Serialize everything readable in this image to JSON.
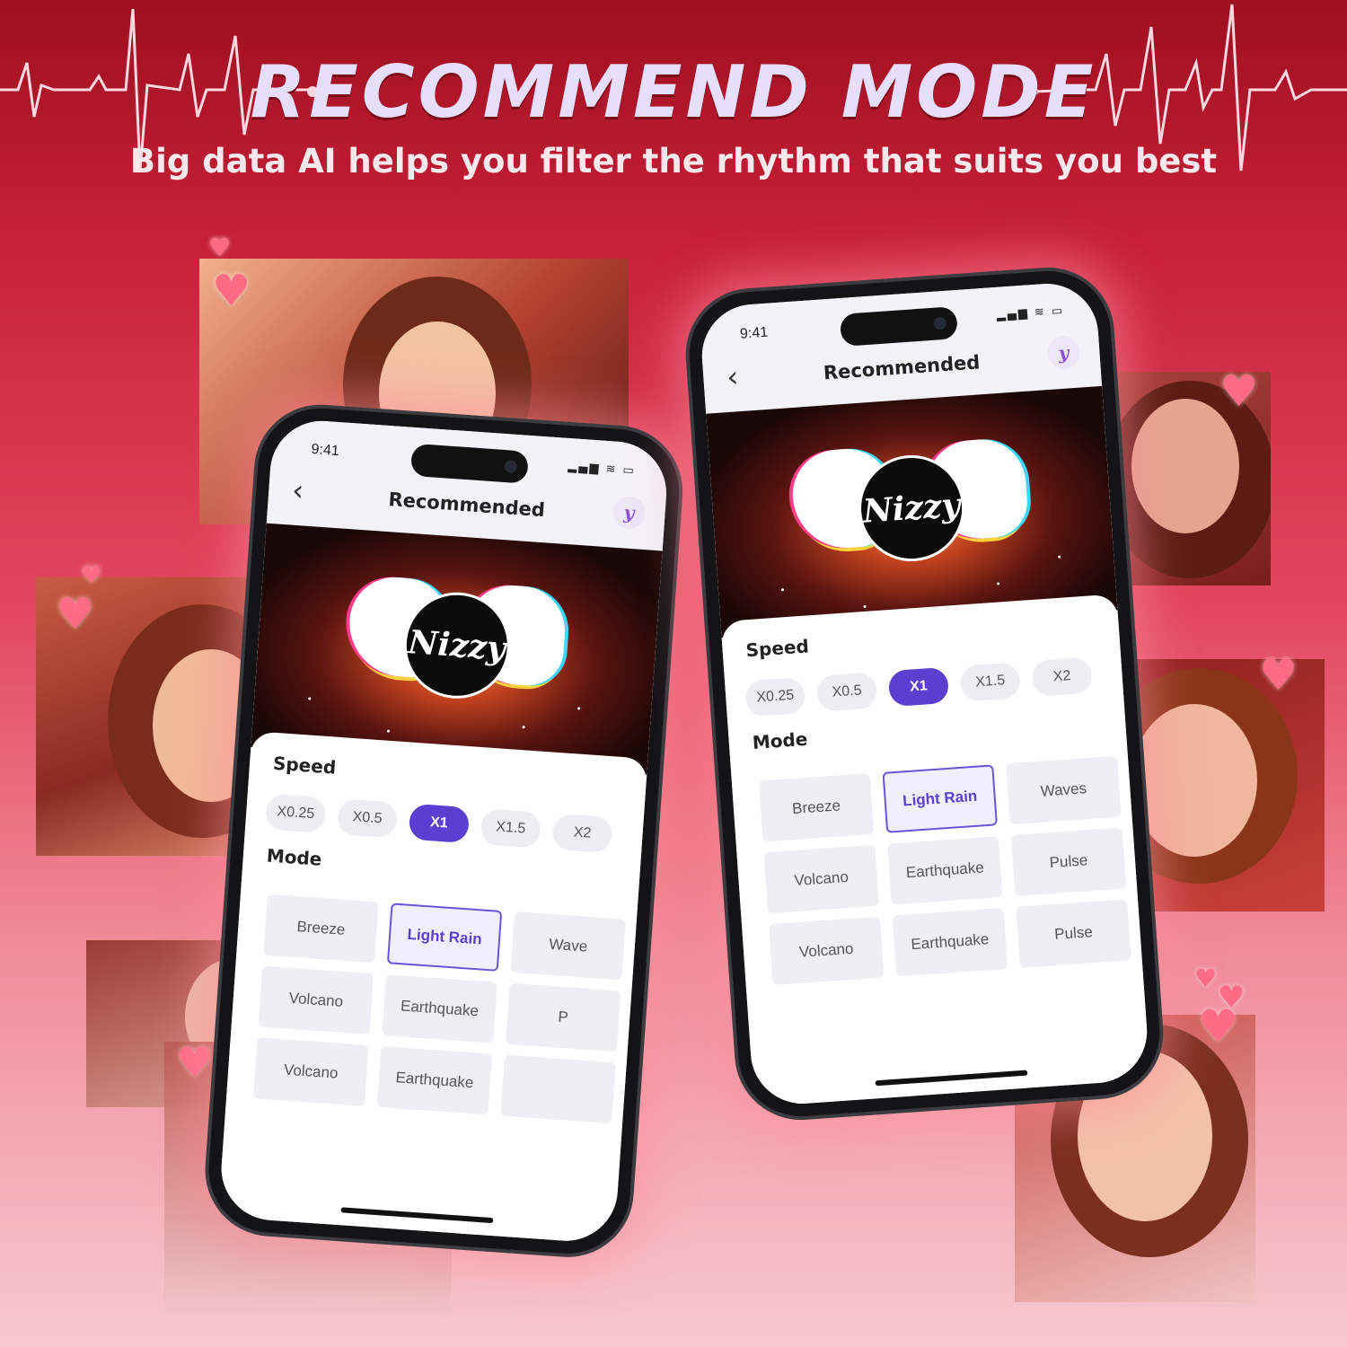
{
  "headline": "RECOMMEND MODE",
  "subline": "Big data AI helps you filter the rhythm that suits you best",
  "colors": {
    "accent": "#5b3fd0",
    "headline": "#e6defa",
    "ecg_line": "#ffd7de",
    "heart": "#ff6b85"
  },
  "hearts": [
    "♥",
    "♥",
    "♥",
    "♥",
    "♥",
    "♥",
    "♥",
    "♥",
    "♥",
    "♥"
  ],
  "phone_left": {
    "status_time": "9:41",
    "status_icons": "▂▄▆ ≋ ▭",
    "back_icon": "‹",
    "title": "Recommended",
    "brand_icon": "y",
    "banner_logo": "Nizzy",
    "speed_label": "Speed",
    "speeds": [
      "X0.25",
      "X0.5",
      "X1",
      "X1.5",
      "X2"
    ],
    "active_speed": "X1",
    "mode_label": "Mode",
    "modes": [
      "Breeze",
      "Light Rain",
      "Wave",
      "Volcano",
      "Earthquake",
      "P",
      "Volcano",
      "Earthquake",
      ""
    ],
    "active_mode": "Light Rain"
  },
  "phone_right": {
    "status_time": "9:41",
    "status_icons": "▂▄▆ ≋ ▭",
    "back_icon": "‹",
    "title": "Recommended",
    "brand_icon": "y",
    "banner_logo": "Nizzy",
    "speed_label": "Speed",
    "speeds": [
      "X0.25",
      "X0.5",
      "X1",
      "X1.5",
      "X2"
    ],
    "active_speed": "X1",
    "mode_label": "Mode",
    "modes": [
      "Breeze",
      "Light Rain",
      "Waves",
      "Volcano",
      "Earthquake",
      "Pulse",
      "Volcano",
      "Earthquake",
      "Pulse"
    ],
    "active_mode": "Light Rain"
  }
}
